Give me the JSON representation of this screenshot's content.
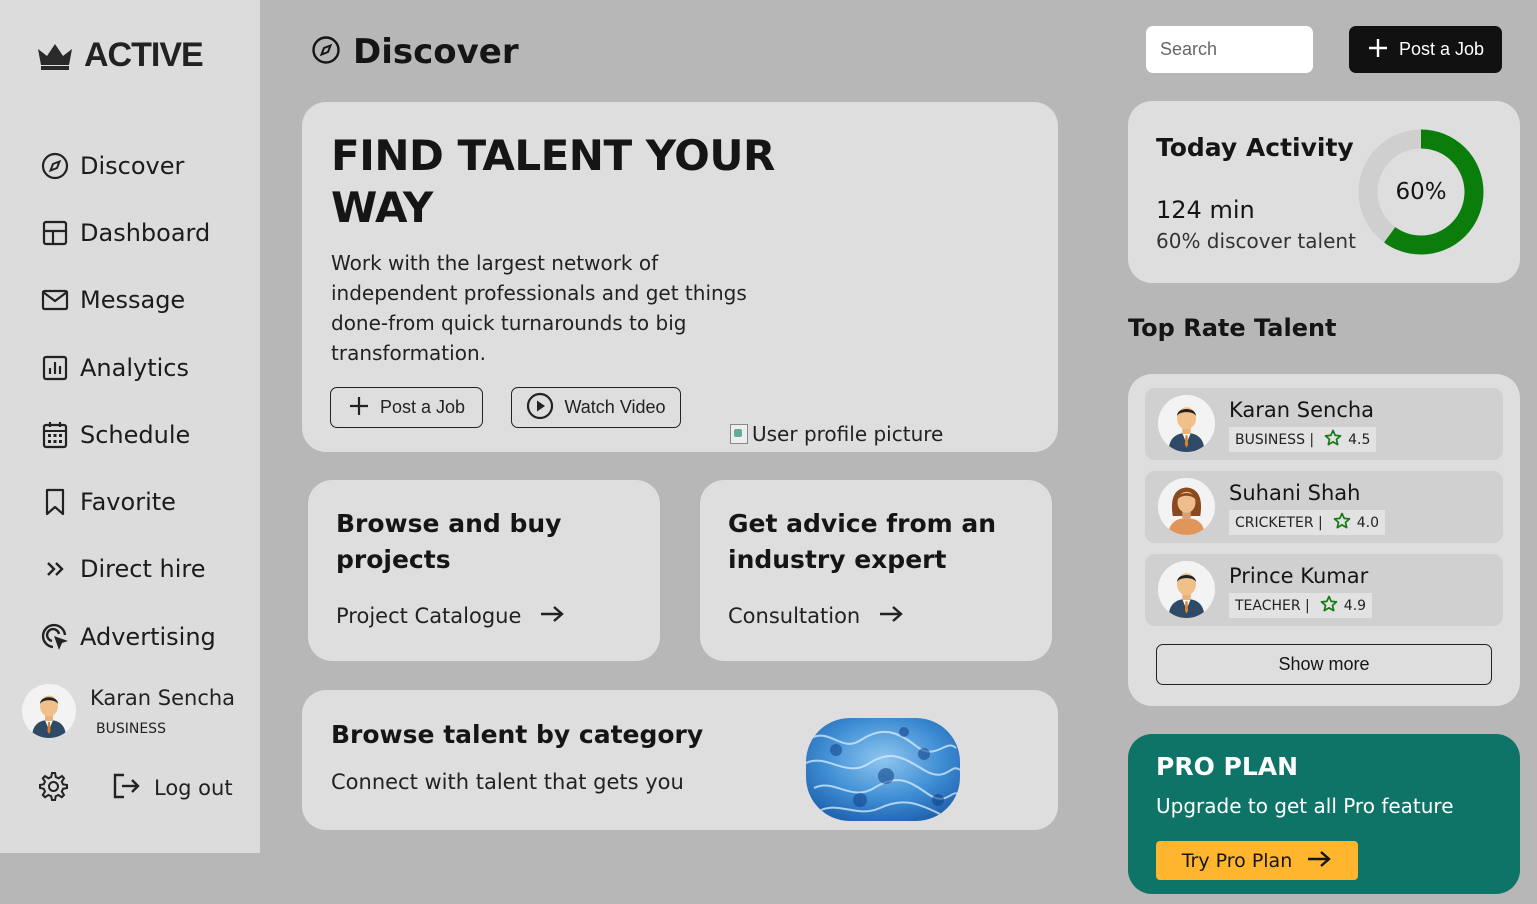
{
  "brand": {
    "name": "ACTIVE"
  },
  "sidebar": {
    "items": [
      {
        "label": "Discover",
        "icon": "compass-icon"
      },
      {
        "label": "Dashboard",
        "icon": "layout-icon"
      },
      {
        "label": "Message",
        "icon": "mail-icon"
      },
      {
        "label": "Analytics",
        "icon": "chart-icon"
      },
      {
        "label": "Schedule",
        "icon": "calendar-icon"
      },
      {
        "label": "Favorite",
        "icon": "bookmark-icon"
      },
      {
        "label": "Direct hire",
        "icon": "double-chevron-icon"
      },
      {
        "label": "Advertising",
        "icon": "target-cursor-icon"
      }
    ],
    "profile": {
      "name": "Karan Sencha",
      "role": "BUSINESS"
    },
    "logout_label": "Log out"
  },
  "header": {
    "title": "Discover",
    "search_placeholder": "Search",
    "post_job_label": "Post a Job"
  },
  "hero": {
    "title": "FIND TALENT YOUR WAY",
    "description": "Work with the largest network of independent professionals and get things done-from quick turnarounds to big transformation.",
    "post_job_label": "Post a Job",
    "watch_video_label": "Watch Video",
    "image_alt": "User profile picture"
  },
  "cards": {
    "projects": {
      "title": "Browse and buy projects",
      "link": "Project Catalogue"
    },
    "advice": {
      "title": "Get advice from an industry expert",
      "link": "Consultation"
    },
    "category": {
      "title": "Browse talent by category",
      "description": "Connect with talent that gets you"
    }
  },
  "activity": {
    "title": "Today Activity",
    "minutes": "124 min",
    "subtitle": "60% discover talent",
    "percent_label": "60%",
    "percent": 60,
    "ring_color": "#0a7d0a",
    "track_color": "#cfcfcf"
  },
  "talent": {
    "heading": "Top Rate Talent",
    "people": [
      {
        "name": "Karan Sencha",
        "role": "BUSINESS |",
        "rating": "4.5",
        "avatar": "male"
      },
      {
        "name": "Suhani Shah",
        "role": "CRICKETER |",
        "rating": "4.0",
        "avatar": "female"
      },
      {
        "name": "Prince Kumar",
        "role": "TEACHER |",
        "rating": "4.9",
        "avatar": "male"
      }
    ],
    "show_more_label": "Show more"
  },
  "pro": {
    "title": "PRO PLAN",
    "subtitle": "Upgrade to get all Pro feature",
    "button_label": "Try Pro Plan",
    "bg_color": "#0f7468",
    "button_color": "#ffb52e"
  }
}
